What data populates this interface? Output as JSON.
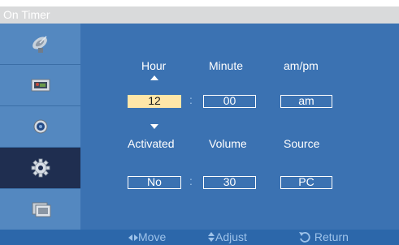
{
  "window": {
    "title": "On Timer"
  },
  "sidebar": {
    "items": [
      {
        "icon": "satellite-dish-icon"
      },
      {
        "icon": "picture-icon"
      },
      {
        "icon": "sound-icon"
      },
      {
        "icon": "gear-icon",
        "active": true
      },
      {
        "icon": "multi-window-icon"
      }
    ]
  },
  "timer": {
    "headers": {
      "hour": "Hour",
      "minute": "Minute",
      "ampm": "am/pm"
    },
    "values": {
      "hour": "12",
      "minute": "00",
      "ampm": "am"
    },
    "separator": ":",
    "selected_field": "hour"
  },
  "settings": {
    "headers": {
      "activated": "Activated",
      "volume": "Volume",
      "source": "Source"
    },
    "values": {
      "activated": "No",
      "volume": "30",
      "source": "PC"
    },
    "separator": ":"
  },
  "footer": {
    "move_label": "Move",
    "adjust_label": "Adjust",
    "return_label": "Return"
  },
  "colors": {
    "sidebar": "#5488c0",
    "sidebar_active": "#1f2e50",
    "main": "#3b72b2",
    "footer": "#2c67aa",
    "footer_text": "#9ec3ea",
    "selected_box": "#ffe6a8"
  }
}
